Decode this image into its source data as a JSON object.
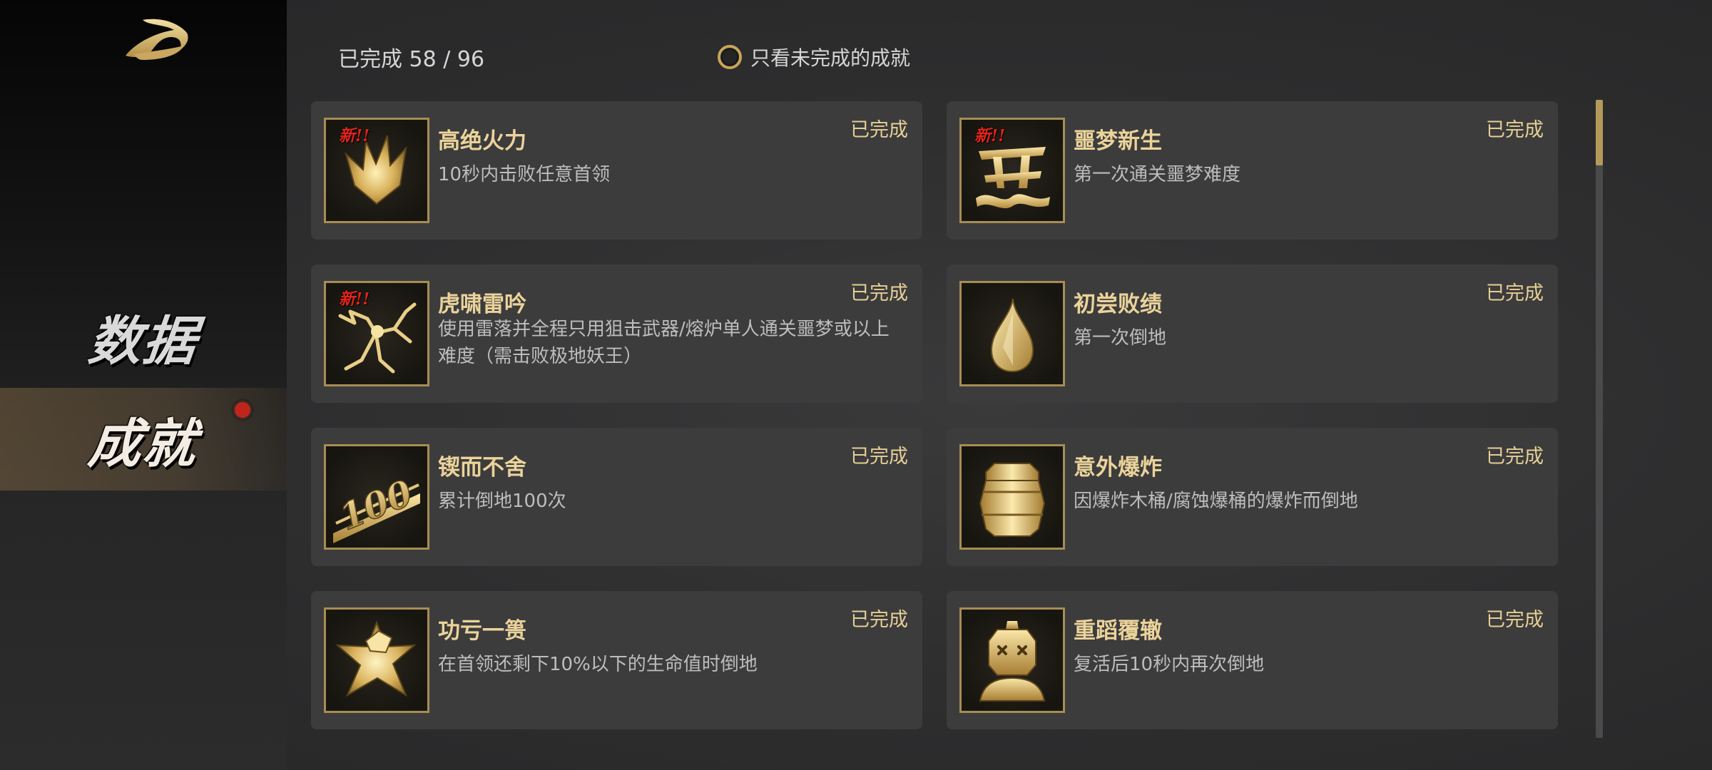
{
  "sidebar": {
    "logo_icon": "stylized-wave-logo-icon",
    "items": [
      {
        "label": "数据",
        "selected": false
      },
      {
        "label": "成就",
        "selected": true,
        "has_notification": true
      }
    ]
  },
  "header": {
    "completed_text": "已完成 58 / 96",
    "filter_label": "只看未完成的成就",
    "filter_checked": false
  },
  "achievements": [
    {
      "title": "高绝火力",
      "desc": "10秒内击败任意首领",
      "status": "已完成",
      "new_badge": "新!!",
      "icon": "flame-burst-icon"
    },
    {
      "title": "噩梦新生",
      "desc": "第一次通关噩梦难度",
      "status": "已完成",
      "new_badge": "新!!",
      "icon": "nightmare-glyph-icon"
    },
    {
      "title": "虎啸雷吟",
      "desc": "使用雷落并全程只用狙击武器/熔炉单人通关噩梦或以上难度（需击败极地妖王）",
      "status": "已完成",
      "new_badge": "新!!",
      "icon": "lightning-crack-icon"
    },
    {
      "title": "初尝败绩",
      "desc": "第一次倒地",
      "status": "已完成",
      "new_badge": "",
      "icon": "teardrop-icon"
    },
    {
      "title": "锲而不舍",
      "desc": "累计倒地100次",
      "status": "已完成",
      "new_badge": "",
      "icon": "hundred-plaque-icon"
    },
    {
      "title": "意外爆炸",
      "desc": "因爆炸木桶/腐蚀爆桶的爆炸而倒地",
      "status": "已完成",
      "new_badge": "",
      "icon": "barrel-icon"
    },
    {
      "title": "功亏一篑",
      "desc": "在首领还剩下10%以下的生命值时倒地",
      "status": "已完成",
      "new_badge": "",
      "icon": "shattered-star-icon"
    },
    {
      "title": "重蹈覆辙",
      "desc": "复活后10秒内再次倒地",
      "status": "已完成",
      "new_badge": "",
      "icon": "knocked-out-figure-icon"
    }
  ],
  "scroll": {
    "position_fraction": 0.0
  },
  "colors": {
    "gold_accent": "#ebd39a",
    "status_gold": "#e6cf94",
    "card_bg": "#3c3c3d",
    "notification_red": "#c0251d"
  }
}
